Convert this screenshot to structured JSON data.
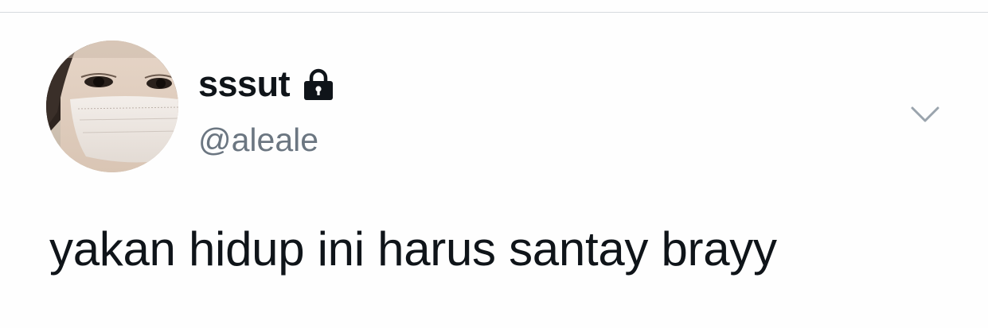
{
  "tweet": {
    "author": {
      "display_name": "sssut",
      "handle": "@aleale",
      "protected": true,
      "avatar_icon": "profile-photo",
      "lock_icon": "lock-icon"
    },
    "text": "yakan hidup ini harus santay brayy",
    "menu_icon": "chevron-down-icon"
  },
  "colors": {
    "background": "#fefefe",
    "text_primary": "#0f1419",
    "text_secondary": "#6b7681",
    "divider": "#d6dadf",
    "caret": "#9aa4ad"
  }
}
